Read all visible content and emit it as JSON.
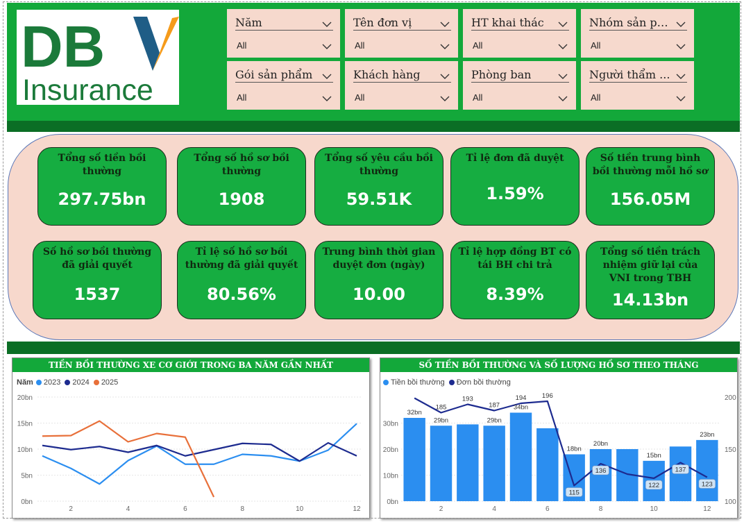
{
  "logo": {
    "line1": "DBV",
    "line2": "Insurance",
    "color_green": "#1b7a3a",
    "color_blue": "#1f5d86",
    "color_orange": "#f59b1b"
  },
  "slicers": [
    {
      "title": "Năm",
      "value": "All"
    },
    {
      "title": "Tên đơn vị",
      "value": "All"
    },
    {
      "title": "HT khai thác",
      "value": "All"
    },
    {
      "title": "Nhóm sản ph...",
      "value": "All"
    },
    {
      "title": "Gói sản phẩm",
      "value": "All"
    },
    {
      "title": "Khách hàng",
      "value": "All"
    },
    {
      "title": "Phòng ban",
      "value": "All"
    },
    {
      "title": "Người thẩm ...",
      "value": "All"
    }
  ],
  "kpis": [
    {
      "label": "Tổng số tiền bồi thường",
      "value": "297.75bn"
    },
    {
      "label": "Tổng số hồ sơ bồi thường",
      "value": "1908"
    },
    {
      "label": "Tổng số yêu cầu bồi thường",
      "value": "59.51K"
    },
    {
      "label": "Tỉ lệ đơn đã duyệt",
      "value": "1.59%"
    },
    {
      "label": "Số tiền trung bình bồi thường mỗi hồ sơ",
      "value": "156.05M"
    },
    {
      "label": "Số hồ sơ bồi thường đã giải quyết",
      "value": "1537"
    },
    {
      "label": "Tỉ lệ số hồ sơ bồi thường đã giải quyết",
      "value": "80.56%"
    },
    {
      "label": "Trung bình thời gian duyệt đơn (ngày)",
      "value": "10.00"
    },
    {
      "label": "Tỉ lệ hợp đồng BT có tái BH chi trả",
      "value": "8.39%"
    },
    {
      "label": "Tổng số tiền trách nhiệm giữ lại của VNI trong TBH",
      "value": "14.13bn"
    }
  ],
  "chart_data": [
    {
      "type": "line",
      "title": "TIỀN BỒI THƯỜNG XE CƠ GIỚI TRONG BA NĂM GẦN NHẤT",
      "legend_title": "Năm",
      "x": [
        1,
        2,
        3,
        4,
        5,
        6,
        7,
        8,
        9,
        10,
        11,
        12
      ],
      "x_ticks": [
        2,
        4,
        6,
        8,
        10,
        12
      ],
      "y_ticks": [
        "0bn",
        "5bn",
        "10bn",
        "15bn",
        "20bn"
      ],
      "ylim": [
        0,
        20
      ],
      "grid": true,
      "legend_position": "top-left",
      "series": [
        {
          "name": "2023",
          "color": "#2b8ef0",
          "values": [
            8.7,
            6.3,
            3.3,
            7.8,
            10.6,
            7.1,
            7.1,
            9.0,
            8.7,
            7.7,
            9.8,
            14.9
          ]
        },
        {
          "name": "2024",
          "color": "#1d2b8f",
          "values": [
            10.7,
            9.9,
            10.5,
            9.4,
            10.7,
            8.7,
            9.9,
            11.1,
            10.9,
            7.7,
            11.2,
            8.7
          ]
        },
        {
          "name": "2025",
          "color": "#e8703a",
          "values": [
            12.5,
            12.6,
            15.4,
            11.4,
            13.0,
            12.3,
            0.8
          ]
        }
      ]
    },
    {
      "type": "bar",
      "title": "SỐ TIỀN BỒI THƯỜNG VÀ SỐ LƯỢNG HỒ SƠ THEO THÁNG",
      "categories": [
        1,
        2,
        3,
        4,
        5,
        6,
        7,
        8,
        9,
        10,
        11,
        12
      ],
      "x_ticks": [
        2,
        4,
        6,
        8,
        10,
        12
      ],
      "y_ticks_left": [
        "0bn",
        "10bn",
        "20bn",
        "30bn"
      ],
      "ylim_left": [
        0,
        40
      ],
      "y_ticks_right": [
        "100",
        "150",
        "200"
      ],
      "ylim_right": [
        100,
        200
      ],
      "legend_position": "top-left",
      "series": [
        {
          "name": "Tiền bồi thường",
          "type": "bar",
          "axis": "left",
          "color": "#2b8ef0",
          "values": [
            32,
            29,
            29.5,
            29,
            34,
            28,
            18,
            20,
            20,
            15.5,
            21,
            23.5
          ],
          "labels": [
            "32bn",
            "29bn",
            "",
            "29bn",
            "34bn",
            "",
            "18bn",
            "20bn",
            "",
            "15bn",
            "",
            "23bn"
          ]
        },
        {
          "name": "Đơn bồi thường",
          "type": "line",
          "axis": "right",
          "color": "#1d2b8f",
          "values": [
            199,
            185,
            193,
            187,
            194,
            196,
            115,
            136,
            126,
            122,
            137,
            123
          ],
          "labels": [
            "",
            "185",
            "193",
            "187",
            "194",
            "196",
            "115",
            "136",
            "",
            "122",
            "137",
            "123"
          ]
        }
      ]
    }
  ]
}
